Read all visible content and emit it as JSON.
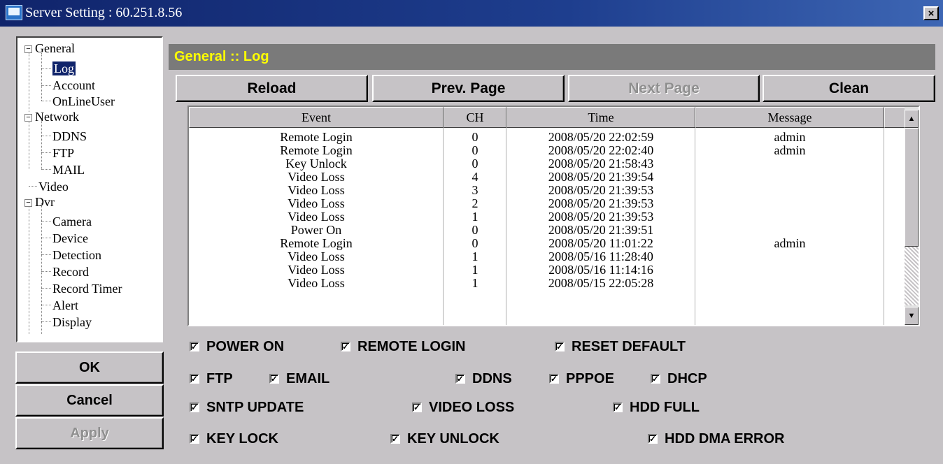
{
  "window": {
    "title": "Server Setting : 60.251.8.56",
    "close_glyph": "×"
  },
  "tree": {
    "general": "General",
    "log": "Log",
    "account": "Account",
    "onlineuser": "OnLineUser",
    "network": "Network",
    "ddns": "DDNS",
    "ftp": "FTP",
    "mail": "MAIL",
    "video": "Video",
    "dvr": "Dvr",
    "camera": "Camera",
    "device": "Device",
    "detection": "Detection",
    "record": "Record",
    "recordtimer": "Record Timer",
    "alert": "Alert",
    "display": "Display",
    "collapse_glyph": "−",
    "selected": "Log"
  },
  "dialog_buttons": {
    "ok": "OK",
    "cancel": "Cancel",
    "apply": "Apply"
  },
  "panel": {
    "title": "General :: Log"
  },
  "toolbar": {
    "reload": "Reload",
    "prev_page": "Prev. Page",
    "next_page": "Next Page",
    "clean": "Clean"
  },
  "table": {
    "columns": [
      "Event",
      "CH",
      "Time",
      "Message"
    ],
    "rows": [
      {
        "event": "Remote Login",
        "ch": "0",
        "time": "2008/05/20 22:02:59",
        "message": "admin"
      },
      {
        "event": "Remote Login",
        "ch": "0",
        "time": "2008/05/20 22:02:40",
        "message": "admin"
      },
      {
        "event": "Key Unlock",
        "ch": "0",
        "time": "2008/05/20 21:58:43",
        "message": ""
      },
      {
        "event": "Video Loss",
        "ch": "4",
        "time": "2008/05/20 21:39:54",
        "message": ""
      },
      {
        "event": "Video Loss",
        "ch": "3",
        "time": "2008/05/20 21:39:53",
        "message": ""
      },
      {
        "event": "Video Loss",
        "ch": "2",
        "time": "2008/05/20 21:39:53",
        "message": ""
      },
      {
        "event": "Video Loss",
        "ch": "1",
        "time": "2008/05/20 21:39:53",
        "message": ""
      },
      {
        "event": "Power On",
        "ch": "0",
        "time": "2008/05/20 21:39:51",
        "message": ""
      },
      {
        "event": "Remote Login",
        "ch": "0",
        "time": "2008/05/20 11:01:22",
        "message": "admin"
      },
      {
        "event": "Video Loss",
        "ch": "1",
        "time": "2008/05/16 11:28:40",
        "message": ""
      },
      {
        "event": "Video Loss",
        "ch": "1",
        "time": "2008/05/16 11:14:16",
        "message": ""
      },
      {
        "event": "Video Loss",
        "ch": "1",
        "time": "2008/05/15 22:05:28",
        "message": ""
      }
    ],
    "scroll_up_glyph": "▲",
    "scroll_down_glyph": "▼"
  },
  "filters": {
    "check_glyph": "✓",
    "power_on": {
      "label": "POWER ON",
      "checked": true
    },
    "remote_login": {
      "label": "REMOTE LOGIN",
      "checked": true
    },
    "reset_default": {
      "label": "RESET DEFAULT",
      "checked": true
    },
    "ftp": {
      "label": "FTP",
      "checked": true
    },
    "email": {
      "label": "EMAIL",
      "checked": true
    },
    "ddns": {
      "label": "DDNS",
      "checked": true
    },
    "pppoe": {
      "label": "PPPOE",
      "checked": true
    },
    "dhcp": {
      "label": "DHCP",
      "checked": true
    },
    "sntp_update": {
      "label": "SNTP UPDATE",
      "checked": true
    },
    "video_loss": {
      "label": "VIDEO LOSS",
      "checked": true
    },
    "hdd_full": {
      "label": "HDD FULL",
      "checked": true
    },
    "key_lock": {
      "label": "KEY LOCK",
      "checked": true
    },
    "key_unlock": {
      "label": "KEY UNLOCK",
      "checked": true
    },
    "hdd_dma_error": {
      "label": "HDD DMA ERROR",
      "checked": true
    }
  }
}
